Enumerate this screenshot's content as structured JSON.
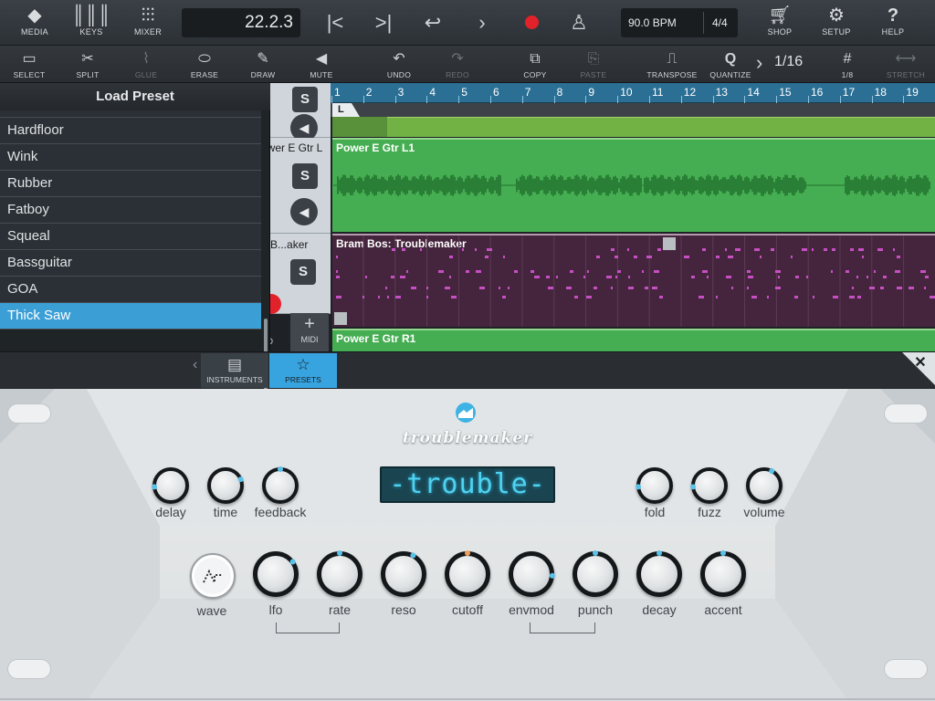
{
  "topbar": {
    "buttons": [
      {
        "label": "MEDIA",
        "icon": "media-icon"
      },
      {
        "label": "KEYS",
        "icon": "piano-keys-icon"
      },
      {
        "label": "MIXER",
        "icon": "mixer-icon"
      },
      {
        "label": "SHOP",
        "icon": "cart-icon"
      },
      {
        "label": "SETUP",
        "icon": "gear-icon"
      },
      {
        "label": "HELP",
        "icon": "question-icon"
      }
    ],
    "position": "22.2.3",
    "tempo": "90.0 BPM",
    "time_signature": "4/4"
  },
  "toolbar": {
    "tools": [
      {
        "label": "SELECT",
        "icon": "select-rect-icon",
        "enabled": true
      },
      {
        "label": "SPLIT",
        "icon": "scissors-icon",
        "enabled": true
      },
      {
        "label": "GLUE",
        "icon": "glue-icon",
        "enabled": false
      },
      {
        "label": "ERASE",
        "icon": "eraser-icon",
        "enabled": true
      },
      {
        "label": "DRAW",
        "icon": "pencil-icon",
        "enabled": true
      },
      {
        "label": "MUTE",
        "icon": "speaker-icon",
        "enabled": true
      },
      {
        "label": "UNDO",
        "icon": "undo-icon",
        "enabled": true
      },
      {
        "label": "REDO",
        "icon": "redo-icon",
        "enabled": false
      },
      {
        "label": "COPY",
        "icon": "copy-icon",
        "enabled": true
      },
      {
        "label": "PASTE",
        "icon": "paste-icon",
        "enabled": false
      },
      {
        "label": "TRANSPOSE",
        "icon": "transpose-icon",
        "enabled": true
      },
      {
        "label": "QUANTIZE",
        "icon": "quantize-icon",
        "enabled": true
      },
      {
        "label": "1/8",
        "icon": "grid-icon",
        "enabled": true
      },
      {
        "label": "STRETCH",
        "icon": "stretch-icon",
        "enabled": false
      }
    ],
    "quantize_value": "1/16"
  },
  "timeline": {
    "bars": [
      "1",
      "2",
      "3",
      "4",
      "5",
      "6",
      "7",
      "8",
      "9",
      "10",
      "11",
      "12",
      "13",
      "14",
      "15",
      "16",
      "17",
      "18",
      "19"
    ],
    "loop_marker": "L"
  },
  "tracks": [
    {
      "header_name": "ower E Gtr L",
      "clip_name": "Power E Gtr L1",
      "type": "audio",
      "color": "#46ae52"
    },
    {
      "header_name": "n B...aker",
      "clip_name": "Bram Bos: Troublemaker",
      "type": "midi",
      "color": "#45253d"
    },
    {
      "header_name": "",
      "clip_name": "Power E Gtr R1",
      "type": "audio",
      "color": "#46ae52"
    }
  ],
  "track_controls": {
    "solo_label": "S",
    "add_midi_label": "MIDI",
    "add_audio_label": "O"
  },
  "preset_panel": {
    "title": "Load Preset",
    "items": [
      "Hardfloor",
      "Wink",
      "Rubber",
      "Fatboy",
      "Squeal",
      "Bassguitar",
      "GOA",
      "Thick Saw"
    ],
    "selected": "Thick Saw"
  },
  "tabs": [
    {
      "label": "INSTRUMENTS",
      "icon": "list-icon",
      "active": false
    },
    {
      "label": "PRESETS",
      "icon": "star-icon",
      "active": true
    }
  ],
  "synth": {
    "name": "troublemaker",
    "display_text": "-trouble-",
    "knob_colors": {
      "accent": "#59c2e8",
      "cutoff": "#f0a05a"
    },
    "top_left_knobs": [
      {
        "label": "delay",
        "value": 0.15
      },
      {
        "label": "time",
        "value": 0.75
      },
      {
        "label": "feedback",
        "value": 0.5
      }
    ],
    "top_right_knobs": [
      {
        "label": "fold",
        "value": 0.15
      },
      {
        "label": "fuzz",
        "value": 0.15
      },
      {
        "label": "volume",
        "value": 0.6
      }
    ],
    "wave_label": "wave",
    "bottom_knobs": [
      {
        "label": "lfo",
        "value": 0.7
      },
      {
        "label": "rate",
        "value": 0.5
      },
      {
        "label": "reso",
        "value": 0.6
      },
      {
        "label": "cutoff",
        "value": 0.5
      },
      {
        "label": "envmod",
        "value": 0.85
      },
      {
        "label": "punch",
        "value": 0.5
      },
      {
        "label": "decay",
        "value": 0.5
      },
      {
        "label": "accent",
        "value": 0.5
      }
    ]
  }
}
